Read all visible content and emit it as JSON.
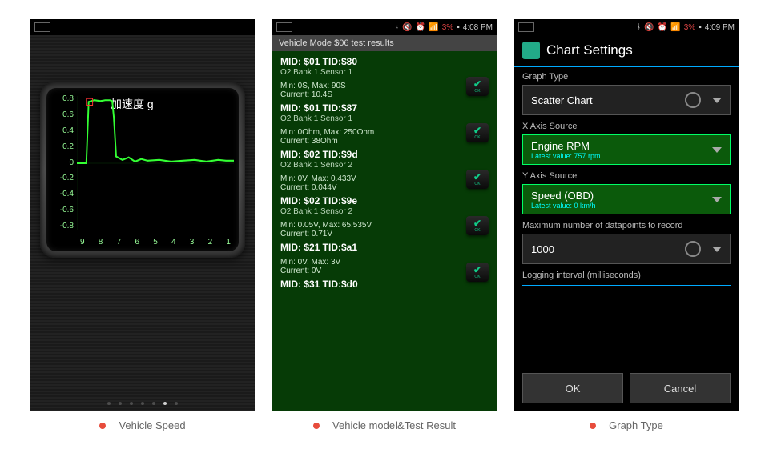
{
  "captions": {
    "c1": "Vehicle Speed",
    "c2": "Vehicle model&Test Result",
    "c3": "Graph Type"
  },
  "status1": {
    "time": ""
  },
  "status2": {
    "battery": "3%",
    "time": "4:08 PM"
  },
  "status3": {
    "battery": "3%",
    "time": "4:09 PM"
  },
  "gauge": {
    "title": "加速度 g",
    "yticks": [
      "0.8",
      "0.6",
      "0.4",
      "0.2",
      "0",
      "-0.2",
      "-0.4",
      "-0.6",
      "-0.8"
    ],
    "xticks": [
      "9",
      "8",
      "7",
      "6",
      "5",
      "4",
      "3",
      "2",
      "1"
    ]
  },
  "p2": {
    "title": "Vehicle Mode $06 test results",
    "ok": "OK",
    "items": [
      {
        "mid": "MID: $01 TID:$80",
        "sen": "O2 Bank 1 Sensor 1",
        "mm": "Min: 0S, Max: 90S",
        "cur": "Current: 10.4S"
      },
      {
        "mid": "MID: $01 TID:$87",
        "sen": "O2 Bank 1 Sensor 1",
        "mm": "Min: 0Ohm, Max: 250Ohm",
        "cur": "Current: 38Ohm"
      },
      {
        "mid": "MID: $02 TID:$9d",
        "sen": "O2 Bank 1 Sensor 2",
        "mm": "Min: 0V, Max: 0.433V",
        "cur": "Current: 0.044V"
      },
      {
        "mid": "MID: $02 TID:$9e",
        "sen": "O2 Bank 1 Sensor 2",
        "mm": "Min: 0.05V, Max: 65.535V",
        "cur": "Current: 0.71V"
      },
      {
        "mid": "MID: $21 TID:$a1",
        "sen": "",
        "mm": "Min: 0V, Max: 3V",
        "cur": "Current: 0V"
      },
      {
        "mid": "MID: $31 TID:$d0",
        "sen": "",
        "mm": "",
        "cur": ""
      }
    ]
  },
  "p3": {
    "title": "Chart Settings",
    "graphType": {
      "label": "Graph Type",
      "value": "Scatter Chart"
    },
    "xaxis": {
      "label": "X Axis Source",
      "value": "Engine RPM",
      "sub": "Latest value: 757 rpm"
    },
    "yaxis": {
      "label": "Y Axis Source",
      "value": "Speed (OBD)",
      "sub": "Latest value: 0 km/h"
    },
    "max": {
      "label": "Maximum number of datapoints to record",
      "value": "1000"
    },
    "interval": {
      "label": "Logging interval (milliseconds)"
    },
    "ok": "OK",
    "cancel": "Cancel"
  },
  "chart_data": {
    "type": "line",
    "title": "加速度 g",
    "xlabel": "",
    "ylabel": "",
    "xlim": [
      1,
      9
    ],
    "ylim": [
      -0.9,
      0.9
    ],
    "x": [
      9.0,
      8.9,
      8.8,
      8.7,
      8.6,
      8.5,
      8.4,
      8.3,
      8.2,
      8.1,
      8.0,
      7.8,
      7.6,
      7.4,
      7.2,
      7.0,
      6.5,
      6.0,
      5.5,
      5.0,
      4.5,
      4.0,
      3.5,
      3.0,
      2.5,
      2.0,
      1.5,
      1.0
    ],
    "y": [
      0.0,
      0.0,
      0.0,
      0.82,
      0.85,
      0.84,
      0.85,
      0.85,
      0.84,
      0.62,
      0.1,
      0.05,
      0.08,
      0.02,
      0.06,
      0.03,
      0.05,
      0.02,
      0.04,
      0.03,
      0.05,
      0.02,
      0.03,
      0.04,
      0.02,
      0.03,
      0.02,
      0.03
    ]
  }
}
